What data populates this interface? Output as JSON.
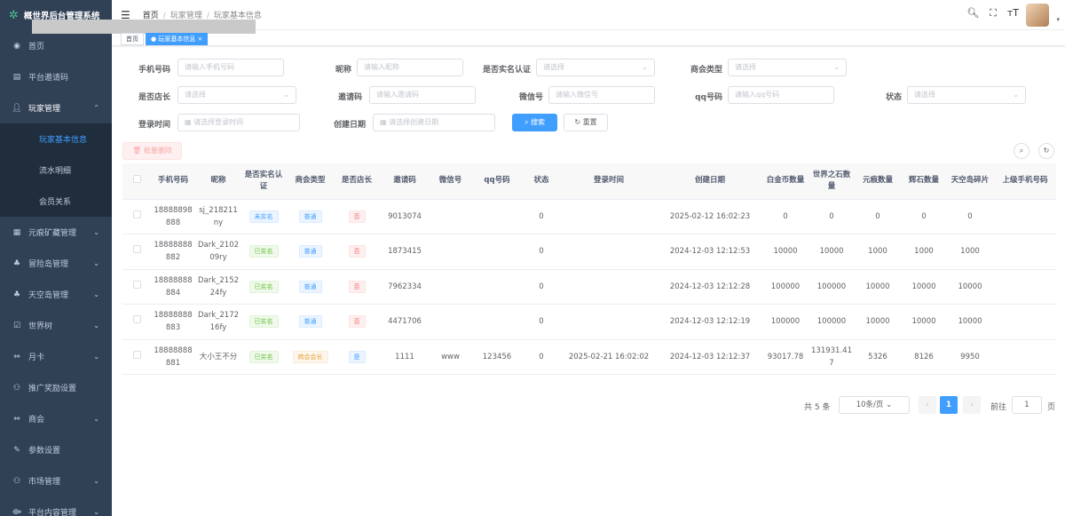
{
  "app": {
    "title": "概世界后台管理系统"
  },
  "colors": {
    "sidebar": "#304156",
    "primary": "#409eff",
    "success": "#67c23a",
    "warning": "#e6a23c",
    "danger": "#f56c6c"
  },
  "sidebar": {
    "items": [
      {
        "label": "首页",
        "icon": "dashboard-icon"
      },
      {
        "label": "平台邀请码",
        "icon": "document-icon"
      },
      {
        "label": "玩家管理",
        "icon": "user-icon",
        "expanded": true,
        "children": [
          {
            "label": "玩家基本信息",
            "active": true
          },
          {
            "label": "流水明细"
          },
          {
            "label": "会员关系"
          }
        ]
      },
      {
        "label": "元痕矿藏管理",
        "icon": "grid-icon"
      },
      {
        "label": "冒险岛管理",
        "icon": "tree-icon"
      },
      {
        "label": "天空岛管理",
        "icon": "tree-icon"
      },
      {
        "label": "世界树",
        "icon": "check-icon"
      },
      {
        "label": "月卡",
        "icon": "coin-icon"
      },
      {
        "label": "推广奖励设置",
        "icon": "people-icon"
      },
      {
        "label": "商会",
        "icon": "coin-icon"
      },
      {
        "label": "参数设置",
        "icon": "edit-icon"
      },
      {
        "label": "市场管理",
        "icon": "people-icon"
      },
      {
        "label": "平台内容管理",
        "icon": "content-icon"
      }
    ]
  },
  "breadcrumb": [
    "首页",
    "玩家管理",
    "玩家基本信息"
  ],
  "tags": [
    {
      "label": "首页"
    },
    {
      "label": "● 玩家基本信息 ×",
      "active": true
    }
  ],
  "filters": {
    "phone": {
      "label": "手机号码",
      "placeholder": "请输入手机号码"
    },
    "nickname": {
      "label": "昵称",
      "placeholder": "请输入昵称"
    },
    "realname": {
      "label": "是否实名认证",
      "placeholder": "请选择"
    },
    "guild": {
      "label": "商会类型",
      "placeholder": "请选择"
    },
    "shopowner": {
      "label": "是否店长",
      "placeholder": "请选择"
    },
    "invite": {
      "label": "邀请码",
      "placeholder": "请输入邀请码"
    },
    "wechat": {
      "label": "微信号",
      "placeholder": "请输入微信号"
    },
    "qq": {
      "label": "qq号码",
      "placeholder": "请输入qq号码"
    },
    "status": {
      "label": "状态",
      "placeholder": "请选择"
    },
    "login_time": {
      "label": "登录时间",
      "placeholder": "请选择登录时间"
    },
    "created": {
      "label": "创建日期",
      "placeholder": "请选择创建日期"
    },
    "search_btn": "搜索",
    "reset_btn": "重置",
    "batch_delete": "批量删除"
  },
  "table": {
    "headers": [
      "",
      "手机号码",
      "昵称",
      "是否实名认证",
      "商会类型",
      "是否店长",
      "邀请码",
      "微信号",
      "qq号码",
      "状态",
      "登录时间",
      "创建日期",
      "白金币数量",
      "世界之石数量",
      "元痕数量",
      "辉石数量",
      "天空岛碎片",
      "上级手机号码"
    ],
    "rows": [
      {
        "phone": "18888898888",
        "nick": "sj_218211ny",
        "real": "未实名",
        "real_tag": "info",
        "guild": "普通",
        "guild_tag": "info",
        "owner": "否",
        "owner_tag": "danger",
        "invite": "9013074",
        "wechat": "",
        "qq": "",
        "status": "0",
        "login": "",
        "created": "2025-02-12 16:02:23",
        "platinum": "0",
        "stone": "0",
        "yuanhen": "0",
        "hui": "0",
        "sky": "0",
        "parent": ""
      },
      {
        "phone": "18888888882",
        "nick": "Dark_210209ry",
        "real": "已实名",
        "real_tag": "success",
        "guild": "普通",
        "guild_tag": "info",
        "owner": "否",
        "owner_tag": "danger",
        "invite": "1873415",
        "wechat": "",
        "qq": "",
        "status": "0",
        "login": "",
        "created": "2024-12-03 12:12:53",
        "platinum": "10000",
        "stone": "10000",
        "yuanhen": "1000",
        "hui": "1000",
        "sky": "1000",
        "parent": ""
      },
      {
        "phone": "18888888884",
        "nick": "Dark_215224fy",
        "real": "已实名",
        "real_tag": "success",
        "guild": "普通",
        "guild_tag": "info",
        "owner": "否",
        "owner_tag": "danger",
        "invite": "7962334",
        "wechat": "",
        "qq": "",
        "status": "0",
        "login": "",
        "created": "2024-12-03 12:12:28",
        "platinum": "100000",
        "stone": "100000",
        "yuanhen": "10000",
        "hui": "10000",
        "sky": "10000",
        "parent": ""
      },
      {
        "phone": "18888888883",
        "nick": "Dark_217216fy",
        "real": "已实名",
        "real_tag": "success",
        "guild": "普通",
        "guild_tag": "info",
        "owner": "否",
        "owner_tag": "danger",
        "invite": "4471706",
        "wechat": "",
        "qq": "",
        "status": "0",
        "login": "",
        "created": "2024-12-03 12:12:19",
        "platinum": "100000",
        "stone": "100000",
        "yuanhen": "10000",
        "hui": "10000",
        "sky": "10000",
        "parent": ""
      },
      {
        "phone": "18888888881",
        "nick": "大小王不分",
        "real": "已实名",
        "real_tag": "success",
        "guild": "商会会长",
        "guild_tag": "warning",
        "owner": "是",
        "owner_tag": "info",
        "invite": "1111",
        "wechat": "www",
        "qq": "123456",
        "status": "0",
        "login": "2025-02-21 16:02:02",
        "created": "2024-12-03 12:12:37",
        "platinum": "93017.78",
        "stone": "131931.417",
        "yuanhen": "5326",
        "hui": "8126",
        "sky": "9950",
        "parent": ""
      }
    ]
  },
  "pagination": {
    "total": "共 5 条",
    "page_size": "10条/页",
    "current": "1",
    "goto_label": "前往",
    "goto_value": "1",
    "page_unit": "页"
  }
}
